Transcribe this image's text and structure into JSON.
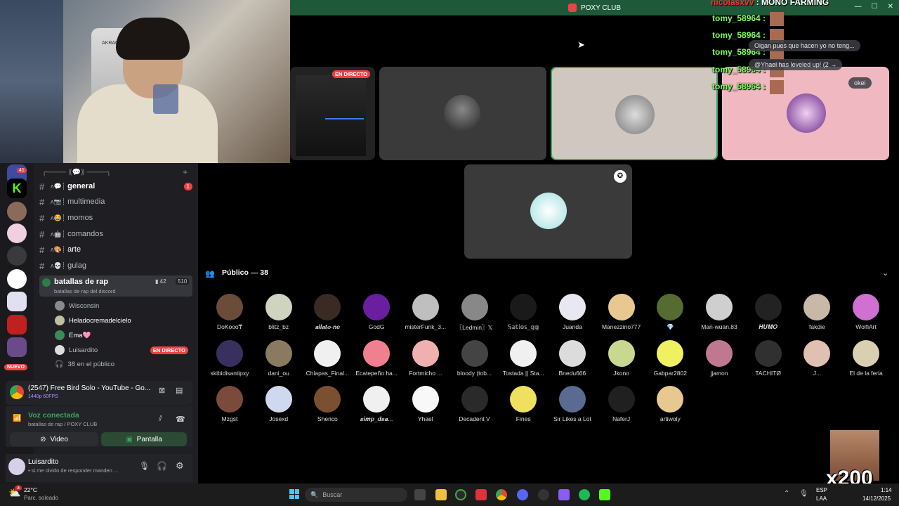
{
  "window": {
    "title": "POXY CLUB"
  },
  "webcam": {
    "chair_label": "AKRACING"
  },
  "chat_overlay": {
    "header_user": "nicolasxvv",
    "header_text": ": MONO FARMING",
    "lines": [
      "tomy_58964 :",
      "tomy_58964 :",
      "tomy_58964 :",
      "tomy_58964 :",
      "tomy_58964 :"
    ],
    "messages": [
      "Oigan pues que hacen yo no teng...",
      "@Yhael has leveled up! (2 →",
      "okei"
    ]
  },
  "sidebar": {
    "server_badge": "41",
    "new_label": "NUEVO",
    "header": "╭──── ⟪💬⟫ ────╮",
    "channels": [
      {
        "prefix": "ʌ💬┊",
        "name": "general",
        "badge": "1"
      },
      {
        "prefix": "ʌ📷┊",
        "name": "multimedia"
      },
      {
        "prefix": "ʌ😂┊",
        "name": "momos"
      },
      {
        "prefix": "ʌ🤖┊",
        "name": "comandos"
      },
      {
        "prefix": "ʌ🎨┊",
        "name": "arte"
      },
      {
        "prefix": "ʌ💀┊",
        "name": "gulag"
      }
    ],
    "voice_channel": {
      "name": "batallas de rap",
      "subtitle": "batallas de rap del discord",
      "video_count": "42",
      "user_count": "510",
      "users": [
        "Wisconsin",
        "Heladocremadelcielo",
        "Ema🩷",
        "Luisardito"
      ],
      "live_label": "EN DIRECTO",
      "public_count": "38 en el público"
    }
  },
  "stream_panel": {
    "title": "(2547) Free Bird Solo - YouTube - Go...",
    "quality": "1440p 60FPS"
  },
  "voice_panel": {
    "status": "Voz conectada",
    "location": "batallas de rap / POXY CLUB",
    "video_label": "Video",
    "screen_label": "Pantalla"
  },
  "user_panel": {
    "name": "Luisardito",
    "status": "• si me olvido de responder manden ..."
  },
  "stage": {
    "live_label": "EN DIRECTO"
  },
  "audience": {
    "header": "Público — 38",
    "members": [
      "DoKooo₸",
      "blitz_bz",
      "𝒂𝒍𝒍𝒂𝒕𝒐-𝒏𝒆",
      "GodG",
      "misterFunk_3...",
      "〖Ledmin〗𝕏",
      "𝕊𝕒𝕥𝕚𝕠𝕤_𝕘𝕘",
      "Juanda",
      "Manezzino777",
      "💎",
      "Mari-wuan.83",
      "𝑯𝑼𝑴𝑶",
      "fakdie",
      "WolfiArt",
      "skibidisantipxy",
      "dani_ou",
      "Chiapas_Final...",
      "Ecatepeño ha...",
      "Fortmicho ...",
      "bloody (tob...",
      "Tostada || Sta...",
      "Bnedu666",
      "Jkono",
      "Gabpar2802",
      "jjamon",
      "TACHITØ",
      "J...",
      "El de la feria",
      "Mzgst",
      "Josexd",
      "Sherico",
      "𝒔𝒊𝒎𝒑_𝒅𝒔𝒂...",
      "Yhael",
      "Decadent V",
      "Fines",
      "Sir Likes a Lot",
      "NaferJ",
      "artiwoly"
    ],
    "colors": [
      "#6b4b3a",
      "#cfd4c0",
      "#3a2a24",
      "#6a1fa0",
      "#bfbfbf",
      "#888888",
      "#1a1a1a",
      "#e8e8f0",
      "#e8c890",
      "#556b2f",
      "#cfcfcf",
      "#222222",
      "#c8b8a8",
      "#d070d0",
      "#3a3060",
      "#8a7a60",
      "#f0f0f0",
      "#f08090",
      "#f0b0b0",
      "#444444",
      "#f0f0f0",
      "#dcdcdc",
      "#c8d890",
      "#f0f060",
      "#c07890",
      "#303030",
      "#e0c0b0",
      "#d8d0b0",
      "#7a4a3a",
      "#d0d8f0",
      "#7a5030",
      "#f0f0f0",
      "#f8f8f8",
      "#2a2a2a",
      "#f0e060",
      "#5a6a90",
      "#202020",
      "#e8c890"
    ]
  },
  "taskbar": {
    "weather_temp": "22°C",
    "weather_desc": "Parc. soleado",
    "weather_badge": "3",
    "search_placeholder": "Buscar",
    "lang": "ESP",
    "lang2": "LAA",
    "time": "1:14",
    "date": "14/12/2025"
  },
  "overlay": {
    "multiplier": "x200"
  }
}
